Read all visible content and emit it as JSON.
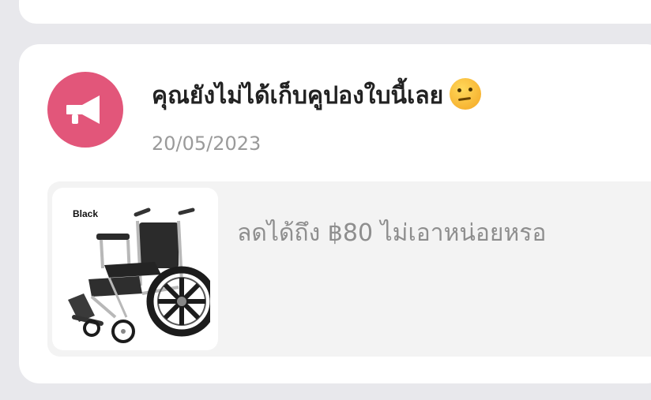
{
  "notification": {
    "title": "คุณยังไม่ได้เก็บคูปองใบนี้เลย",
    "emoji_icon": "thinking-face-icon",
    "date": "20/05/2023",
    "icon": "megaphone-icon",
    "icon_bg": "#e2567a"
  },
  "promo": {
    "image_label": "Black",
    "text": "ลดได้ถึง ฿80 ไม่เอาหน่อยหรอ"
  }
}
